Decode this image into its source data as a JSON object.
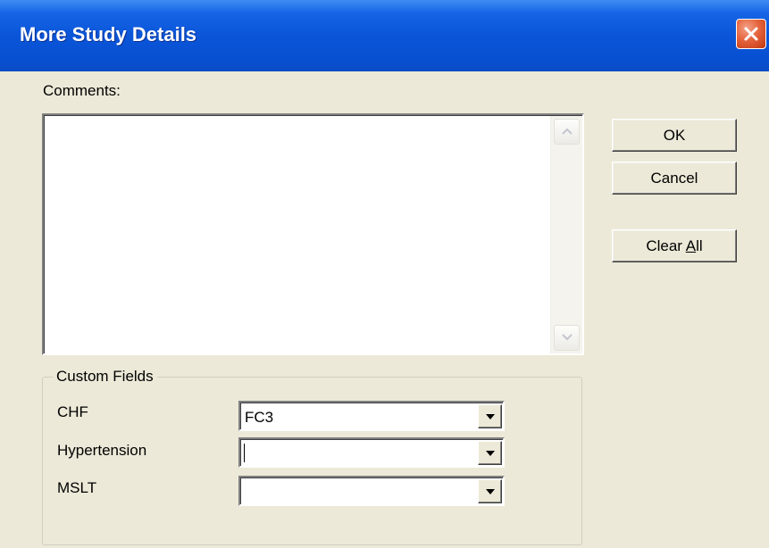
{
  "window": {
    "title": "More Study Details",
    "close_icon": "close-icon",
    "accent": "#0a55d8",
    "close_color": "#e5643d"
  },
  "comments": {
    "label": "Comments:",
    "value": ""
  },
  "buttons": {
    "ok_label": "OK",
    "cancel_label": "Cancel",
    "clear_all_label_prefix": "Clear ",
    "clear_all_label_mnemonic": "A",
    "clear_all_label_suffix": "ll"
  },
  "custom_fields": {
    "legend": "Custom Fields",
    "fields": [
      {
        "label": "CHF",
        "value": "FC3"
      },
      {
        "label": "Hypertension",
        "value": ""
      },
      {
        "label": "MSLT",
        "value": ""
      }
    ]
  },
  "icons": {
    "scroll_up": "chevron-up-icon",
    "scroll_down": "chevron-down-icon",
    "dropdown": "dropdown-arrow-icon"
  }
}
